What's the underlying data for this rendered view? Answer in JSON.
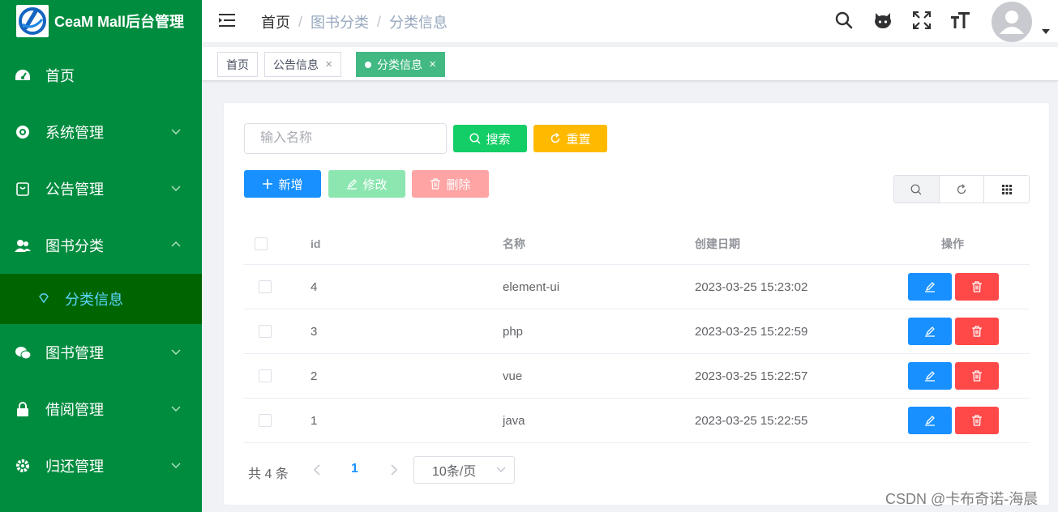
{
  "app": {
    "title": "CeaM Mall后台管理"
  },
  "sidebar": {
    "items": [
      {
        "label": "首页",
        "icon": "dashboard-icon"
      },
      {
        "label": "系统管理",
        "icon": "gear-icon"
      },
      {
        "label": "公告管理",
        "icon": "notice-icon"
      },
      {
        "label": "图书分类",
        "icon": "users-icon"
      },
      {
        "label": "图书管理",
        "icon": "wechat-icon"
      },
      {
        "label": "借阅管理",
        "icon": "lock-icon"
      },
      {
        "label": "归还管理",
        "icon": "gear-icon"
      }
    ],
    "submenu": {
      "label": "分类信息",
      "icon": "diamond-icon"
    },
    "colors": {
      "bg": "#008c3f",
      "active_bg": "#006400",
      "active_text": "#5cd6ff"
    }
  },
  "header": {
    "breadcrumb": [
      "首页",
      "图书分类",
      "分类信息"
    ]
  },
  "tags": [
    {
      "label": "首页",
      "closable": false,
      "active": false
    },
    {
      "label": "公告信息",
      "closable": true,
      "active": false
    },
    {
      "label": "分类信息",
      "closable": true,
      "active": true
    }
  ],
  "toolbar": {
    "search_placeholder": "输入名称",
    "search_label": "搜索",
    "reset_label": "重置",
    "add_label": "新增",
    "edit_label": "修改",
    "delete_label": "删除"
  },
  "table": {
    "columns": [
      "id",
      "名称",
      "创建日期",
      "操作"
    ],
    "rows": [
      {
        "id": "4",
        "name": "element-ui",
        "created": "2023-03-25 15:23:02"
      },
      {
        "id": "3",
        "name": "php",
        "created": "2023-03-25 15:22:59"
      },
      {
        "id": "2",
        "name": "vue",
        "created": "2023-03-25 15:22:57"
      },
      {
        "id": "1",
        "name": "java",
        "created": "2023-03-25 15:22:55"
      }
    ]
  },
  "pagination": {
    "total_text": "共 4 条",
    "current_page": "1",
    "page_size": "10条/页"
  },
  "watermark": "CSDN @卡布奇诺-海晨"
}
